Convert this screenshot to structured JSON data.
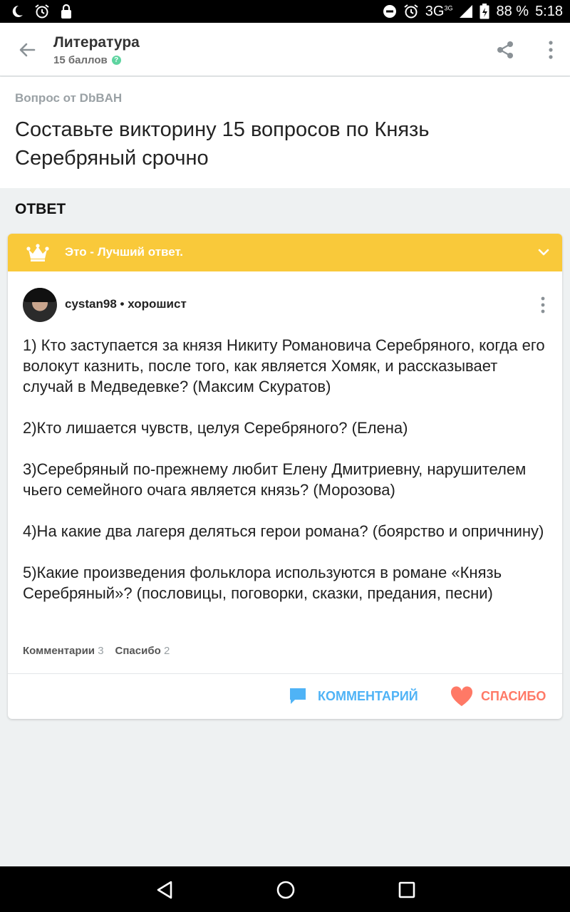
{
  "status_bar": {
    "network": "3G",
    "network_sup": "3G",
    "battery": "88 %",
    "time": "5:18",
    "icons": [
      "moon-icon",
      "alarm-icon",
      "lock-icon",
      "dnd-icon",
      "alarm-icon",
      "signal-icon",
      "battery-icon"
    ]
  },
  "app_bar": {
    "subject": "Литература",
    "points": "15 баллов",
    "icons": [
      "back-arrow-icon",
      "question-icon",
      "share-icon",
      "more-vert-icon"
    ]
  },
  "question": {
    "author": "Вопрос от DbBAH",
    "text": "Составьте викторину 15 вопросов по Князь Серебряный срочно"
  },
  "answer_section": {
    "label": "ОТВЕТ",
    "best_banner": "Это - Лучший ответ.",
    "author": "cystan98",
    "rank": "хорошист",
    "paragraphs": [
      "1) Кто заступается за князя Никиту Романовича Серебряного, когда его волокут казнить, после того, как является Хомяк, и рассказывает случай в Медведевке? (Максим Скуратов)",
      "2)Кто лишается чувств, целуя Серебряного? (Елена)",
      "3)Серебряный по-прежнему любит Елену Дмитриевну, нарушителем чьего семейного очага является князь? (Морозова)",
      "4)На какие два лагеря деляться герои романа? (боярство и опричнину)",
      "5)Какие произведения фольклора используются в романе «Князь Серебряный»? (пословицы, поговорки, сказки, предания, песни)"
    ],
    "stats": {
      "comments_label": "Комментарии",
      "comments_count": "3",
      "thanks_label": "Спасибо",
      "thanks_count": "2"
    },
    "actions": {
      "comment": "КОММЕНТАРИЙ",
      "thanks": "СПАСИБО"
    }
  },
  "colors": {
    "banner": "#f9c93a",
    "comment": "#4fb3f6",
    "thanks": "#ff7966",
    "background": "#eef1f2"
  }
}
